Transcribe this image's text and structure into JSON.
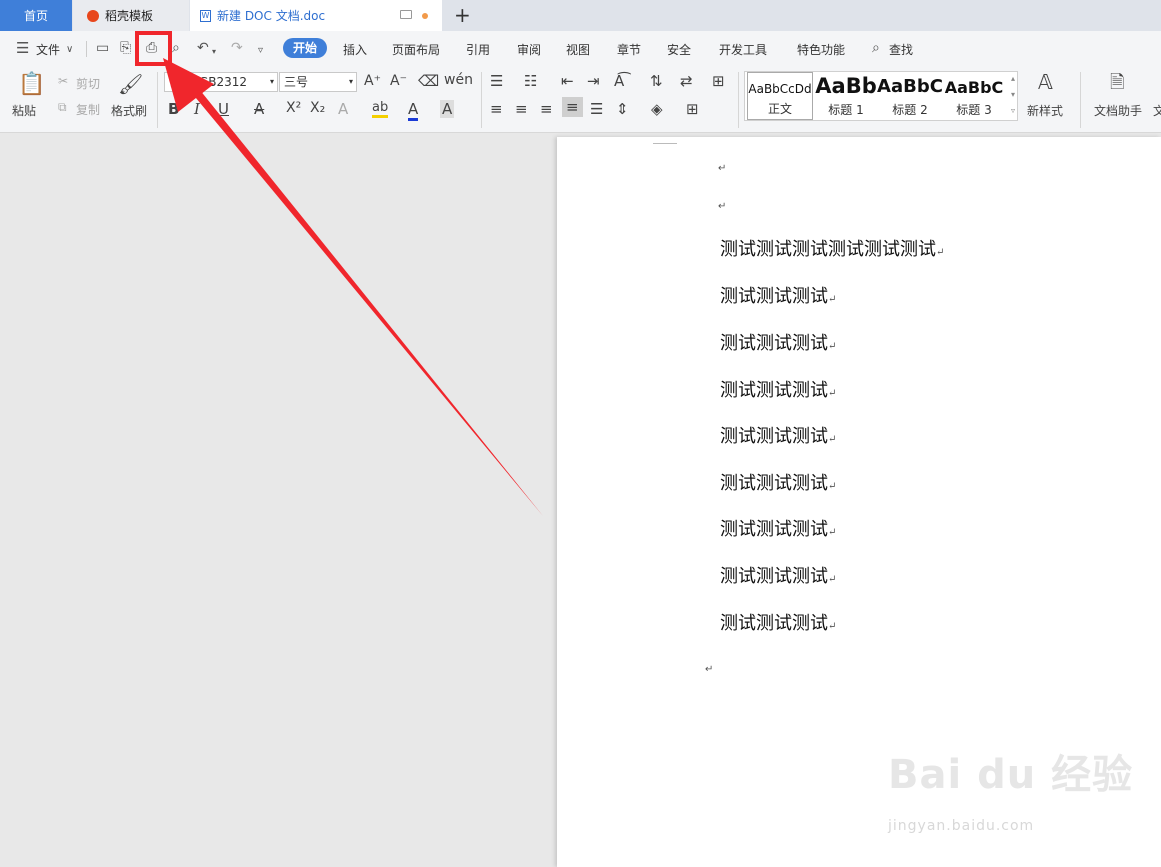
{
  "tabs": [
    {
      "label": "首页"
    },
    {
      "label": "稻壳模板"
    },
    {
      "label": "新建 DOC 文档.doc"
    }
  ],
  "new_tab_label": "+",
  "menu": {
    "file": "文件",
    "items": [
      "开始",
      "插入",
      "页面布局",
      "引用",
      "审阅",
      "视图",
      "章节",
      "安全",
      "开发工具",
      "特色功能",
      "查找"
    ]
  },
  "toolbar": {
    "paste": "粘贴",
    "cut": "剪切",
    "copy": "复制",
    "format_painter": "格式刷",
    "font_name": "仿宋_GB2312",
    "font_size": "三号",
    "styles": [
      {
        "preview": "AaBbCcDd",
        "name": "正文"
      },
      {
        "preview": "AaBb",
        "name": "标题 1"
      },
      {
        "preview": "AaBbC",
        "name": "标题 2"
      },
      {
        "preview": "AaBbC",
        "name": "标题 3"
      }
    ],
    "new_style": "新样式",
    "doc_assistant": "文档助手",
    "doc_assistant_tail": "文"
  },
  "document": {
    "lines": [
      "测试测试测试测试测试测试",
      "测试测试测试",
      "测试测试测试",
      "测试测试测试",
      "测试测试测试",
      "测试测试测试",
      "测试测试测试",
      "测试测试测试",
      "测试测试测试"
    ],
    "paragraph_mark": "↵"
  },
  "watermark": {
    "logo": "Bai du 经验",
    "url": "jingyan.baidu.com"
  },
  "colors": {
    "accent": "#3f7fd9",
    "highlight_red": "#f0262c"
  }
}
